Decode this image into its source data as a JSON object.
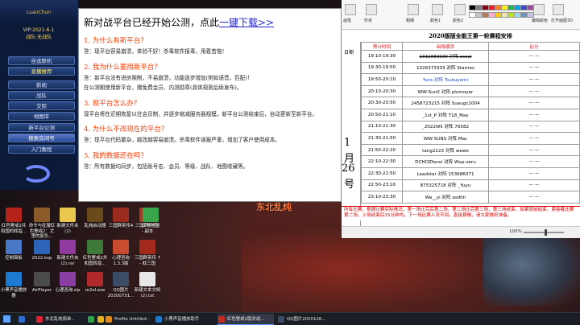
{
  "client": {
    "logo": "LuanChun",
    "version": "VIP:2021-6-1",
    "team": "战队:无战队",
    "menu": [
      {
        "label": "自选联机",
        "style": "normal"
      },
      {
        "label": "直播推荐",
        "style": "hot"
      },
      {
        "label": "新闻",
        "style": "normal"
      },
      {
        "label": "战队",
        "style": "normal"
      },
      {
        "label": "交际",
        "style": "normal"
      },
      {
        "label": "地图库",
        "style": "normal"
      },
      {
        "label": "新平台公测",
        "style": "normal"
      },
      {
        "label": "搜索房间号",
        "style": "sel"
      },
      {
        "label": "入门教程",
        "style": "normal"
      }
    ]
  },
  "notice": {
    "headline": "新对战平台已经开始公测，点此",
    "download_link": "一键下载>>",
    "sections": [
      {
        "q": "1. 为什么有新平台？",
        "a": [
          "答：现平台容易崩溃，体验不好！杀毒软件报毒，用着苦恼！"
        ]
      },
      {
        "q": "2. 我为什么要用新平台？",
        "a": [
          "答：新平台没有进房限制，不易崩溃，功能逐步增加(例如语音，匹配)！",
          "在公测期使用新平台，赠免费会员、内测勋章(具体规则后续发布)。"
        ]
      },
      {
        "q": "3. 现平台怎么办？",
        "a": [
          "现平台将在近期恢复以往会员制，并逐步缩减服务器规模。新平台公测结束后，自动更新至新平台。"
        ]
      },
      {
        "q": "4. 为什么不改现在的平台？",
        "a": [
          "答：现平台代码繁杂，越改越容易崩溃。杀毒软件误报严重，增加了客户使用成本。"
        ]
      },
      {
        "q": "5. 我的数据还在吗？",
        "a": [
          "答：所有数据均同步，包括账号名、会员、等级、战队、地图收藏等。"
        ]
      }
    ]
  },
  "excel": {
    "ribbon": [
      {
        "label": "画笔",
        "icon": "brush-icon"
      },
      {
        "label": "形状",
        "icon": "shape-icon"
      },
      {
        "label": "粗细",
        "icon": "size-icon"
      },
      {
        "label": "颜色1",
        "icon": "color-icon"
      },
      {
        "label": "颜色2",
        "icon": "color-icon"
      },
      {
        "label": "编辑颜色",
        "icon": "palette-icon"
      },
      {
        "label": "打开画图3D",
        "icon": "paint3d-icon"
      }
    ],
    "swatches": [
      "#000000",
      "#7f7f7f",
      "#880015",
      "#ed1c24",
      "#ff7f27",
      "#fff200",
      "#22b14c",
      "#00a2e8",
      "#3f48cc",
      "#a349a4",
      "#ffffff",
      "#c3c3c3",
      "#b97a57",
      "#ffaec9",
      "#ffc90e",
      "#efe4b0",
      "#b5e61d",
      "#99d9ea",
      "#7092be",
      "#c8bfe7"
    ],
    "title": "2020版版全能王第一轮赛程安排",
    "date_header": "日期",
    "date_big": [
      "1",
      "月",
      "26",
      "号"
    ],
    "headers": [
      "预计时间",
      "出场顺序",
      "比分"
    ],
    "rows": [
      {
        "time": "19:10-19:30",
        "match": "1332683939 对阵 ocoal",
        "score": "— —",
        "strike": true,
        "blue": false
      },
      {
        "time": "19:30-19:50",
        "match": "1026373333 对阵 Starries",
        "score": "— —",
        "strike": false,
        "blue": false
      },
      {
        "time": "19:50-20:10",
        "match": "Yura 对阵 Tsukuyomi",
        "score": "— —",
        "strike": false,
        "blue": true
      },
      {
        "time": "20:10-20:30",
        "match": "WW-SunX 对阵 plumoyer",
        "score": "— —",
        "strike": false,
        "blue": false
      },
      {
        "time": "20:30-20:50",
        "match": "2458723215 对阵 Suaugc2004",
        "score": "— —",
        "strike": false,
        "blue": false
      },
      {
        "time": "20:50-21:10",
        "match": "_1st_P 对阵 T18_May",
        "score": "— —",
        "strike": false,
        "blue": false
      },
      {
        "time": "21:10-21:30",
        "match": "_2022Wll 对阵 76582",
        "score": "— —",
        "strike": false,
        "blue": false
      },
      {
        "time": "21:30-21:50",
        "match": "WW-SUNS 对阵 Mac",
        "score": "— —",
        "strike": false,
        "blue": false
      },
      {
        "time": "21:50-22:10",
        "match": "tang2223 对阵 wewo",
        "score": "— —",
        "strike": false,
        "blue": false
      },
      {
        "time": "22:10-22:30",
        "match": "DCHOZfansi 对阵 Wxp-xeru",
        "score": "— —",
        "strike": false,
        "blue": false
      },
      {
        "time": "22:30-22:50",
        "match": "Loadstar 对阵 153686071",
        "score": "— —",
        "strike": false,
        "blue": false
      },
      {
        "time": "22:50-23:10",
        "match": "875325718 对阵 _Yuyu",
        "score": "— —",
        "strike": false,
        "blue": false
      },
      {
        "time": "23:10-23:30",
        "match": "Wa__yi 对阵 asdhh",
        "score": "— —",
        "strike": false,
        "blue": false
      }
    ],
    "red_note": "所有比赛，根据比赛实际情况，第一场比完后第二场，第二场比完第三场，第三场结束，如果提前结束，紧接着比赛第二场。上场结束后15分钟内，下一场比赛人员不到，直接算输，请大家做好准备。",
    "zoom": "100%"
  },
  "desktop": {
    "art_title": "东北乱炖",
    "icons": [
      {
        "label": "红色警戒2共和国的辉煌...",
        "color": "#b3231a",
        "col": 0,
        "row": 0
      },
      {
        "label": "命令与征服红色警戒2：尤里的复仇...",
        "color": "#8d5a2a",
        "col": 1,
        "row": 0
      },
      {
        "label": "新建文件夹(2)",
        "color": "#e9c84d",
        "col": 2,
        "row": 0
      },
      {
        "label": "乱炖启动器",
        "color": "#6b4a1a",
        "col": 3,
        "row": 0
      },
      {
        "label": "三国群英传4",
        "color": "#9b2a1f",
        "col": 4,
        "row": 0
      },
      {
        "label": "三国群英传4 - 副本",
        "color": "#a33b22",
        "col": 5,
        "row": 0
      },
      {
        "label": "红警地图",
        "color": "#3aa64b",
        "col": 5,
        "row": 0.5
      },
      {
        "label": "控制面板",
        "color": "#4a78c9",
        "col": 0,
        "row": 1
      },
      {
        "label": "2022.ksp",
        "color": "#2e64b8",
        "col": 1,
        "row": 1
      },
      {
        "label": "新建文件夹(2).rar",
        "color": "#8f3c9e",
        "col": 2,
        "row": 1
      },
      {
        "label": "红色警戒2共和国辉煌...",
        "color": "#3d7a3a",
        "col": 3,
        "row": 1
      },
      {
        "label": "心理咨询 1.3.3版",
        "color": "#c94c2e",
        "col": 4,
        "row": 1
      },
      {
        "label": "三国群英传 7 - 蚊三国",
        "color": "#a32a1a",
        "col": 5,
        "row": 1
      },
      {
        "label": "小黑声音播放器",
        "color": "#1d7ad1",
        "col": 0,
        "row": 2
      },
      {
        "label": "AirPlayer",
        "color": "#4a4a4a",
        "col": 1,
        "row": 2
      },
      {
        "label": "心理咨询.zip",
        "color": "#8b3ea4",
        "col": 2,
        "row": 2
      },
      {
        "label": "re2ol.exe",
        "color": "#b02a2a",
        "col": 3,
        "row": 2
      },
      {
        "label": "QQ图片20200731...",
        "color": "#3b4c66",
        "col": 4,
        "row": 2
      },
      {
        "label": "新建文本文档(2).txt",
        "color": "#e8e8e8",
        "col": 5,
        "row": 2
      }
    ]
  },
  "taskbar": {
    "items": [
      {
        "label": "",
        "color": "#2d6bd6",
        "active": false
      },
      {
        "label": "东北乱炖简单..",
        "color": "#d23",
        "active": false
      },
      {
        "label": "",
        "color": "#2aa34a",
        "active": false
      },
      {
        "label": "",
        "color": "#e5b420",
        "active": false
      },
      {
        "label": "Profile Untitled - ...",
        "color": "#e38a1c",
        "active": false
      },
      {
        "label": "小黑声音播放助手",
        "color": "#1d7ad1",
        "active": false
      },
      {
        "label": "红色警戒2版对战...",
        "color": "#c82a1f",
        "active": true
      },
      {
        "label": "QQ图片2020126...",
        "color": "#3b4c66",
        "active": false
      }
    ]
  }
}
